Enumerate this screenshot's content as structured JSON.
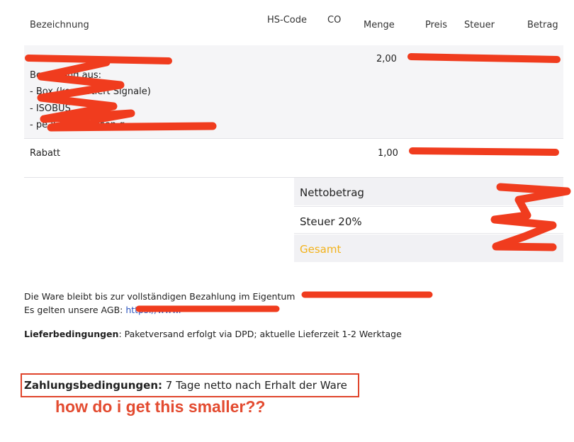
{
  "table": {
    "headers": {
      "description": "Bezeichnung",
      "hs_code": "HS-Code",
      "co": "CO",
      "quantity": "Menge",
      "price": "Preis",
      "tax": "Steuer",
      "amount": "Betrag"
    },
    "rows": [
      {
        "lines": [
          "",
          "Bestehend aus:",
          "- Box (konvertiert Signale)",
          "- ISOBUS",
          "- pe ISOBUS reisen g"
        ],
        "quantity": "2,00",
        "redacted": true
      },
      {
        "lines": [
          "Rabatt"
        ],
        "quantity": "1,00",
        "redacted": true
      }
    ]
  },
  "totals": {
    "net_label": "Nettobetrag",
    "tax_label": "Steuer 20%",
    "total_label": "Gesamt",
    "total_color": "#f2b21b"
  },
  "footer": {
    "ownership_line": "Die Ware bleibt bis zur vollständigen Bezahlung im Eigentum",
    "agb_line": "Es gelten unsere AGB:",
    "delivery_label": "Lieferbedingungen",
    "delivery_text": ": Paketversand erfolgt via DPD; aktuelle Lieferzeit 1-2 Werktage",
    "payment_label": "Zahlungsbedingungen:",
    "payment_text": " 7 Tage netto nach Erhalt der Ware"
  },
  "annotation": {
    "question": "how do i get this smaller??",
    "color": "#e34b30"
  }
}
